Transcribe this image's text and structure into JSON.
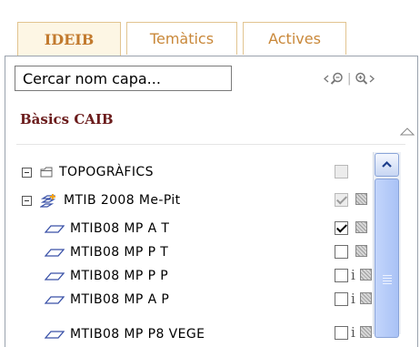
{
  "tabs": [
    {
      "label": "IDEIB",
      "active": true
    },
    {
      "label": "Temàtics",
      "active": false
    },
    {
      "label": "Actives",
      "active": false
    }
  ],
  "search": {
    "value": "Cercar nom capa..."
  },
  "section": {
    "title": "Bàsics CAIB"
  },
  "tree": [
    {
      "label": "TOPOGRÀFICS",
      "icon": "folder-icon",
      "checked": false,
      "disabled": true,
      "info": false,
      "legend": false
    },
    {
      "label": "MTIB 2008 Me-Pit",
      "icon": "layer-group-add-icon",
      "checked": true,
      "disabled": true,
      "info": false,
      "legend": true
    },
    {
      "label": "MTIB08 MP A T",
      "icon": "layer-icon",
      "checked": true,
      "disabled": false,
      "info": false,
      "legend": true
    },
    {
      "label": "MTIB08 MP P T",
      "icon": "layer-icon",
      "checked": false,
      "disabled": false,
      "info": false,
      "legend": true
    },
    {
      "label": "MTIB08 MP P P",
      "icon": "layer-icon",
      "checked": false,
      "disabled": false,
      "info": true,
      "legend": true
    },
    {
      "label": "MTIB08 MP A P",
      "icon": "layer-icon",
      "checked": false,
      "disabled": false,
      "info": true,
      "legend": true
    },
    {
      "label": "MTIB08 MP P8 VEGE",
      "icon": "layer-icon",
      "checked": false,
      "disabled": false,
      "info": true,
      "legend": true
    }
  ],
  "info_glyph": "i",
  "colors": {
    "tab_text": "#c9883a",
    "section_title": "#6b1c1c",
    "scroll_thumb": "#a9c2f6"
  }
}
